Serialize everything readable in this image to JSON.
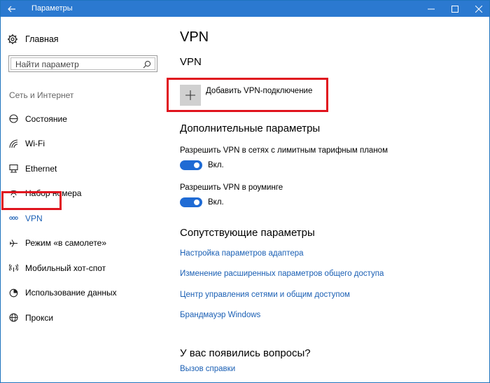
{
  "window": {
    "title": "Параметры",
    "back_icon": "arrow-left-icon",
    "accent": "#2b79d0"
  },
  "sidebar": {
    "home_label": "Главная",
    "search_placeholder": "Найти параметр",
    "section_label": "Сеть и Интернет",
    "items": [
      {
        "label": "Состояние",
        "icon": "status-icon"
      },
      {
        "label": "Wi-Fi",
        "icon": "wifi-icon"
      },
      {
        "label": "Ethernet",
        "icon": "ethernet-icon"
      },
      {
        "label": "Набор номера",
        "icon": "dialup-icon"
      },
      {
        "label": "VPN",
        "icon": "vpn-icon",
        "active": true
      },
      {
        "label": "Режим «в самолете»",
        "icon": "airplane-icon"
      },
      {
        "label": "Мобильный хот-спот",
        "icon": "hotspot-icon"
      },
      {
        "label": "Использование данных",
        "icon": "data-usage-icon"
      },
      {
        "label": "Прокси",
        "icon": "globe-icon"
      }
    ]
  },
  "main": {
    "page_title": "VPN",
    "vpn_subtitle": "VPN",
    "add_vpn_label": "Добавить VPN-подключение",
    "advanced_title": "Дополнительные параметры",
    "options": [
      {
        "label": "Разрешить VPN в сетях с лимитным тарифным планом",
        "state": "Вкл."
      },
      {
        "label": "Разрешить VPN в роуминге",
        "state": "Вкл."
      }
    ],
    "related_title": "Сопутствующие параметры",
    "related_links": [
      "Настройка параметров адаптера",
      "Изменение расширенных параметров общего доступа",
      "Центр управления сетями и общим доступом",
      "Брандмауэр Windows"
    ],
    "questions_title": "У вас появились вопросы?",
    "help_link": "Вызов справки"
  },
  "colors": {
    "link": "#1a5fb4",
    "toggle_on": "#1f6bd4",
    "highlight": "#e0141e"
  }
}
